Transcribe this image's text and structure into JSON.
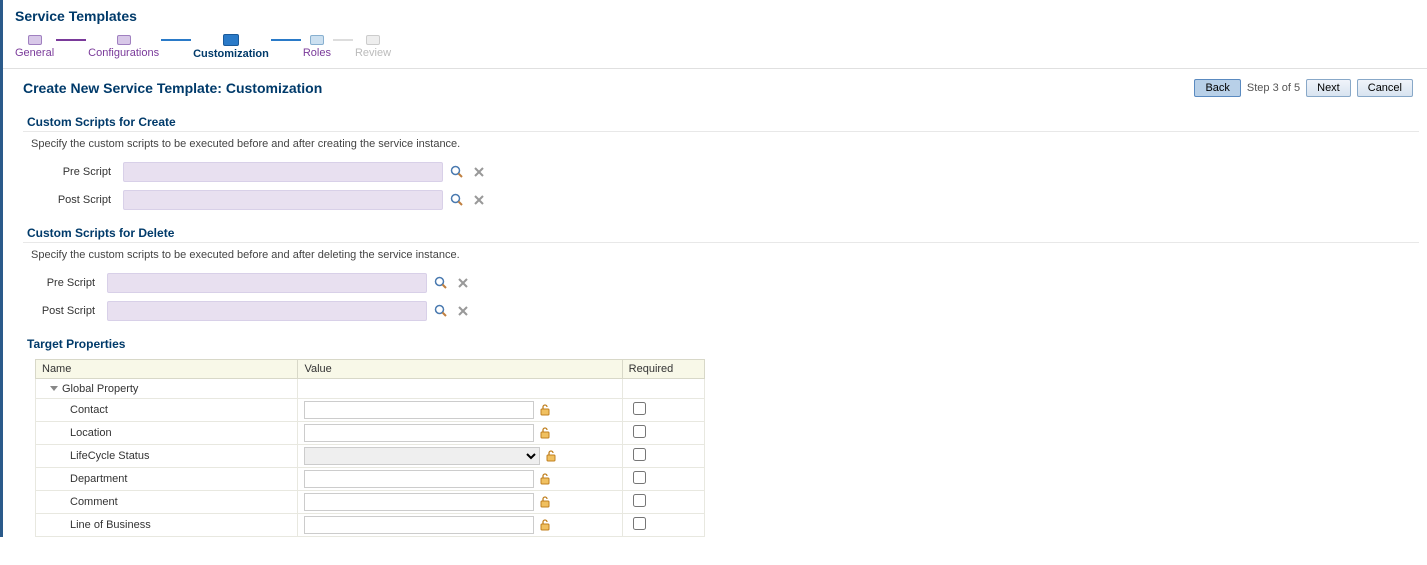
{
  "page_title": "Service Templates",
  "wizard": {
    "steps": [
      {
        "label": "General",
        "state": "completed"
      },
      {
        "label": "Configurations",
        "state": "completed"
      },
      {
        "label": "Customization",
        "state": "current"
      },
      {
        "label": "Roles",
        "state": "future"
      },
      {
        "label": "Review",
        "state": "disabled"
      }
    ]
  },
  "header": {
    "title": "Create New Service Template: Customization",
    "back_label": "Back",
    "next_label": "Next",
    "cancel_label": "Cancel",
    "step_counter": "Step 3 of 5"
  },
  "create_scripts": {
    "title": "Custom Scripts for Create",
    "desc": "Specify the custom scripts to be executed before and after creating the service instance.",
    "pre_label": "Pre Script",
    "post_label": "Post Script",
    "pre_value": "",
    "post_value": ""
  },
  "delete_scripts": {
    "title": "Custom Scripts for Delete",
    "desc": "Specify the custom scripts to be executed before and after deleting the service instance.",
    "pre_label": "Pre Script",
    "post_label": "Post Script",
    "pre_value": "",
    "post_value": ""
  },
  "target_properties": {
    "title": "Target Properties",
    "col_name": "Name",
    "col_value": "Value",
    "col_required": "Required",
    "group_label": "Global Property",
    "rows": [
      {
        "name": "Contact",
        "value": "",
        "type": "text",
        "required": false
      },
      {
        "name": "Location",
        "value": "",
        "type": "text",
        "required": false
      },
      {
        "name": "LifeCycle Status",
        "value": "",
        "type": "select",
        "required": false
      },
      {
        "name": "Department",
        "value": "",
        "type": "text",
        "required": false
      },
      {
        "name": "Comment",
        "value": "",
        "type": "text",
        "required": false
      },
      {
        "name": "Line of Business",
        "value": "",
        "type": "text",
        "required": false
      }
    ]
  }
}
